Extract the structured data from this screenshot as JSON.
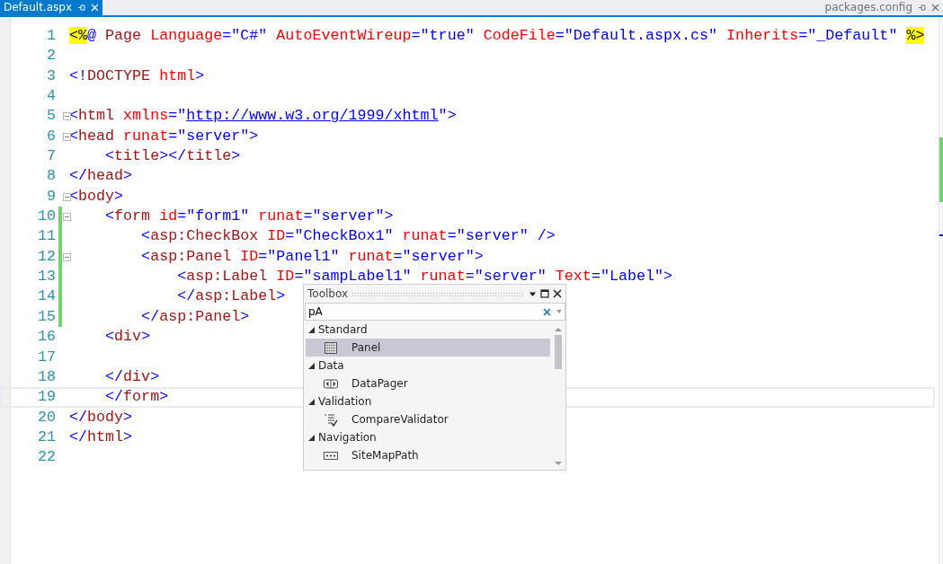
{
  "tabs": [
    {
      "label": "Default.aspx",
      "selected": true
    },
    {
      "label": "packages.config",
      "selected": false
    }
  ],
  "editor": {
    "lines": [
      {
        "number": "1",
        "foldable": false,
        "changed": false,
        "current": false,
        "tokens": [
          {
            "kind": "highlight",
            "text": "<%"
          },
          {
            "kind": "delim",
            "text": "@"
          },
          {
            "kind": "tag",
            "text": " Page"
          },
          {
            "kind": "attr",
            "text": " Language"
          },
          {
            "kind": "delim",
            "text": "="
          },
          {
            "kind": "value",
            "text": "\"C#\""
          },
          {
            "kind": "attr",
            "text": " AutoEventWireup"
          },
          {
            "kind": "delim",
            "text": "="
          },
          {
            "kind": "value",
            "text": "\"true\""
          },
          {
            "kind": "attr",
            "text": " CodeFile"
          },
          {
            "kind": "delim",
            "text": "="
          },
          {
            "kind": "value",
            "text": "\"Default.aspx.cs\""
          },
          {
            "kind": "attr",
            "text": " Inherits"
          },
          {
            "kind": "delim",
            "text": "="
          },
          {
            "kind": "value",
            "text": "\"_Default\" "
          },
          {
            "kind": "highlight",
            "text": "%>"
          }
        ]
      },
      {
        "number": "2",
        "foldable": false,
        "changed": false,
        "current": false
      },
      {
        "number": "3",
        "foldable": false,
        "changed": false,
        "current": false,
        "tokens": [
          {
            "kind": "delim",
            "text": "<!"
          },
          {
            "kind": "tag",
            "text": "DOCTYPE"
          },
          {
            "kind": "attr",
            "text": " html"
          },
          {
            "kind": "delim",
            "text": ">"
          }
        ]
      },
      {
        "number": "4",
        "foldable": false,
        "changed": false,
        "current": false
      },
      {
        "number": "5",
        "foldable": true,
        "changed": false,
        "current": false,
        "tokens": [
          {
            "kind": "delim",
            "text": "<"
          },
          {
            "kind": "tag",
            "text": "html"
          },
          {
            "kind": "attr",
            "text": " xmlns"
          },
          {
            "kind": "delim",
            "text": "="
          },
          {
            "kind": "value",
            "text": "\""
          },
          {
            "kind": "url",
            "text": "http://www.w3.org/1999/xhtml"
          },
          {
            "kind": "value",
            "text": "\""
          },
          {
            "kind": "delim",
            "text": ">"
          }
        ]
      },
      {
        "number": "6",
        "foldable": true,
        "changed": false,
        "current": false,
        "tokens": [
          {
            "kind": "delim",
            "text": "<"
          },
          {
            "kind": "tag",
            "text": "head"
          },
          {
            "kind": "attr",
            "text": " runat"
          },
          {
            "kind": "delim",
            "text": "="
          },
          {
            "kind": "value",
            "text": "\"server\""
          },
          {
            "kind": "delim",
            "text": ">"
          }
        ]
      },
      {
        "number": "7",
        "foldable": false,
        "changed": false,
        "current": false,
        "tokens": [
          {
            "kind": "delim",
            "text": "    <"
          },
          {
            "kind": "tag",
            "text": "title"
          },
          {
            "kind": "delim",
            "text": "></"
          },
          {
            "kind": "tag",
            "text": "title"
          },
          {
            "kind": "delim",
            "text": ">"
          }
        ]
      },
      {
        "number": "8",
        "foldable": false,
        "changed": false,
        "current": false,
        "tokens": [
          {
            "kind": "delim",
            "text": "</"
          },
          {
            "kind": "tag",
            "text": "head"
          },
          {
            "kind": "delim",
            "text": ">"
          }
        ]
      },
      {
        "number": "9",
        "foldable": true,
        "changed": false,
        "current": false,
        "tokens": [
          {
            "kind": "delim",
            "text": "<"
          },
          {
            "kind": "tag",
            "text": "body"
          },
          {
            "kind": "delim",
            "text": ">"
          }
        ]
      },
      {
        "number": "10",
        "foldable": true,
        "changed": true,
        "current": false,
        "tokens": [
          {
            "kind": "delim",
            "text": "    <"
          },
          {
            "kind": "tag",
            "text": "form"
          },
          {
            "kind": "attr",
            "text": " id"
          },
          {
            "kind": "delim",
            "text": "="
          },
          {
            "kind": "value",
            "text": "\"form1\""
          },
          {
            "kind": "attr",
            "text": " runat"
          },
          {
            "kind": "delim",
            "text": "="
          },
          {
            "kind": "value",
            "text": "\"server\""
          },
          {
            "kind": "delim",
            "text": ">"
          }
        ]
      },
      {
        "number": "11",
        "foldable": false,
        "changed": true,
        "current": false,
        "tokens": [
          {
            "kind": "delim",
            "text": "        <"
          },
          {
            "kind": "tag",
            "text": "asp:CheckBox"
          },
          {
            "kind": "attr",
            "text": " ID"
          },
          {
            "kind": "delim",
            "text": "="
          },
          {
            "kind": "value",
            "text": "\"CheckBox1\""
          },
          {
            "kind": "attr",
            "text": " runat"
          },
          {
            "kind": "delim",
            "text": "="
          },
          {
            "kind": "value",
            "text": "\"server\""
          },
          {
            "kind": "delim",
            "text": " />"
          }
        ]
      },
      {
        "number": "12",
        "foldable": true,
        "changed": true,
        "current": false,
        "tokens": [
          {
            "kind": "delim",
            "text": "        <"
          },
          {
            "kind": "tag",
            "text": "asp:Panel"
          },
          {
            "kind": "attr",
            "text": " ID"
          },
          {
            "kind": "delim",
            "text": "="
          },
          {
            "kind": "value",
            "text": "\"Panel1\""
          },
          {
            "kind": "attr",
            "text": " runat"
          },
          {
            "kind": "delim",
            "text": "="
          },
          {
            "kind": "value",
            "text": "\"server\""
          },
          {
            "kind": "delim",
            "text": ">"
          }
        ]
      },
      {
        "number": "13",
        "foldable": false,
        "changed": true,
        "current": false,
        "tokens": [
          {
            "kind": "delim",
            "text": "            <"
          },
          {
            "kind": "tag",
            "text": "asp:Label"
          },
          {
            "kind": "attr",
            "text": " ID"
          },
          {
            "kind": "delim",
            "text": "="
          },
          {
            "kind": "value",
            "text": "\"sampLabel1\""
          },
          {
            "kind": "attr",
            "text": " runat"
          },
          {
            "kind": "delim",
            "text": "="
          },
          {
            "kind": "value",
            "text": "\"server\""
          },
          {
            "kind": "attr",
            "text": " Text"
          },
          {
            "kind": "delim",
            "text": "="
          },
          {
            "kind": "value",
            "text": "\"Label\""
          },
          {
            "kind": "delim",
            "text": ">"
          }
        ]
      },
      {
        "number": "14",
        "foldable": false,
        "changed": true,
        "current": false,
        "tokens": [
          {
            "kind": "delim",
            "text": "            </"
          },
          {
            "kind": "tag",
            "text": "asp:Label"
          },
          {
            "kind": "delim",
            "text": ">"
          }
        ]
      },
      {
        "number": "15",
        "foldable": false,
        "changed": true,
        "current": false,
        "tokens": [
          {
            "kind": "delim",
            "text": "        </"
          },
          {
            "kind": "tag",
            "text": "asp:Panel"
          },
          {
            "kind": "delim",
            "text": ">"
          }
        ]
      },
      {
        "number": "16",
        "foldable": false,
        "changed": false,
        "current": false,
        "tokens": [
          {
            "kind": "delim",
            "text": "    <"
          },
          {
            "kind": "tag",
            "text": "div"
          },
          {
            "kind": "delim",
            "text": ">"
          }
        ]
      },
      {
        "number": "17",
        "foldable": false,
        "changed": false,
        "current": false
      },
      {
        "number": "18",
        "foldable": false,
        "changed": false,
        "current": false,
        "tokens": [
          {
            "kind": "delim",
            "text": "    </"
          },
          {
            "kind": "tag",
            "text": "div"
          },
          {
            "kind": "delim",
            "text": ">"
          }
        ]
      },
      {
        "number": "19",
        "foldable": false,
        "changed": false,
        "current": true,
        "tokens": [
          {
            "kind": "delim",
            "text": "    </"
          },
          {
            "kind": "tag",
            "text": "form"
          },
          {
            "kind": "delim",
            "text": ">"
          }
        ]
      },
      {
        "number": "20",
        "foldable": false,
        "changed": false,
        "current": false,
        "tokens": [
          {
            "kind": "delim",
            "text": "</"
          },
          {
            "kind": "tag",
            "text": "body"
          },
          {
            "kind": "delim",
            "text": ">"
          }
        ]
      },
      {
        "number": "21",
        "foldable": false,
        "changed": false,
        "current": false,
        "tokens": [
          {
            "kind": "delim",
            "text": "</"
          },
          {
            "kind": "tag",
            "text": "html"
          },
          {
            "kind": "delim",
            "text": ">"
          }
        ]
      },
      {
        "number": "22",
        "foldable": false,
        "changed": false,
        "current": false
      }
    ]
  },
  "toolbox": {
    "title": "Toolbox",
    "search": {
      "value": "pA"
    },
    "groups": [
      {
        "label": "Standard",
        "expanded": true,
        "items": [
          {
            "label": "Panel",
            "selected": true
          }
        ]
      },
      {
        "label": "Data",
        "expanded": true,
        "items": [
          {
            "label": "DataPager",
            "selected": false
          }
        ]
      },
      {
        "label": "Validation",
        "expanded": true,
        "items": [
          {
            "label": "CompareValidator",
            "selected": false
          }
        ]
      },
      {
        "label": "Navigation",
        "expanded": true,
        "items": [
          {
            "label": "SiteMapPath",
            "selected": false
          }
        ]
      }
    ]
  }
}
